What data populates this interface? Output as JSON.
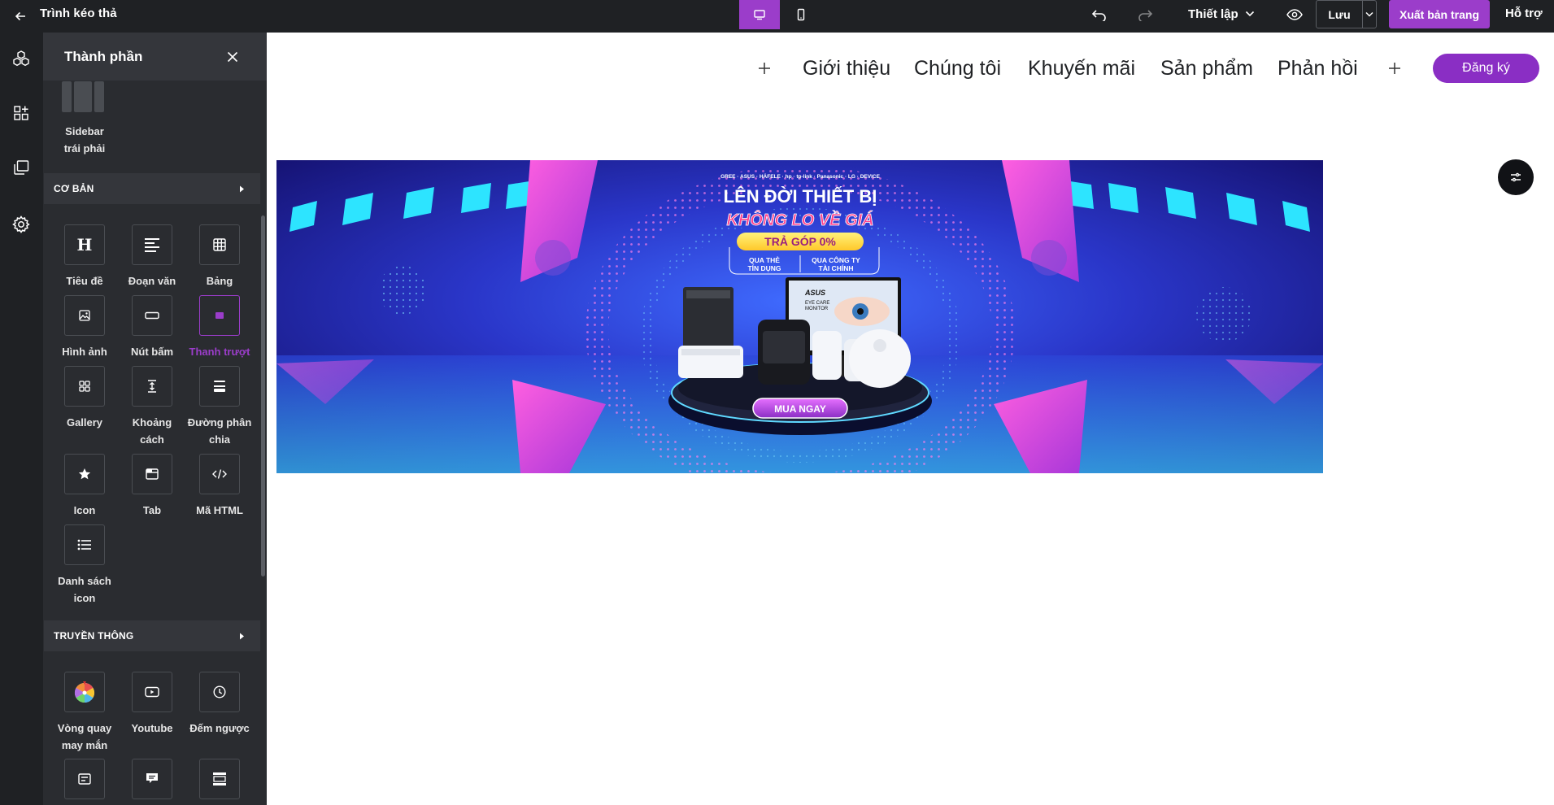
{
  "topbar": {
    "title": "Trình kéo thả",
    "settings_label": "Thiết lập",
    "save_label": "Lưu",
    "publish_label": "Xuất bản trang",
    "help_label": "Hỗ trợ",
    "desktop_mode_color": "#9b3dca"
  },
  "panel": {
    "title": "Thành phần",
    "sidebar_item": {
      "label_line1": "Sidebar",
      "label_line2": "trái phải"
    },
    "section_basic": "CƠ BẢN",
    "section_media": "TRUYỀN THÔNG",
    "basic_items": [
      {
        "label": "Tiêu đề",
        "icon": "heading-icon"
      },
      {
        "label": "Đoạn văn",
        "icon": "paragraph-icon"
      },
      {
        "label": "Bảng",
        "icon": "table-icon"
      },
      {
        "label": "Hình ảnh",
        "icon": "image-icon"
      },
      {
        "label": "Nút bấm",
        "icon": "button-icon"
      },
      {
        "label": "Thanh trượt",
        "icon": "slider-icon",
        "active": true
      },
      {
        "label": "Gallery",
        "icon": "gallery-icon"
      },
      {
        "label_line1": "Khoảng",
        "label_line2": "cách",
        "icon": "spacer-icon"
      },
      {
        "label_line1": "Đường phân",
        "label_line2": "chia",
        "icon": "divider-icon"
      },
      {
        "label": "Icon",
        "icon": "star-icon"
      },
      {
        "label": "Tab",
        "icon": "tab-icon"
      },
      {
        "label": "Mã HTML",
        "icon": "code-icon"
      },
      {
        "label_line1": "Danh sách",
        "label_line2": "icon",
        "icon": "icon-list-icon"
      }
    ],
    "media_items": [
      {
        "label_line1": "Vòng quay",
        "label_line2": "may mắn",
        "icon": "lucky-wheel-icon"
      },
      {
        "label": "Youtube",
        "icon": "youtube-icon"
      },
      {
        "label": "Đếm ngược",
        "icon": "countdown-icon"
      }
    ],
    "accent_color": "#9b3dca"
  },
  "canvas": {
    "nav": {
      "items": [
        "Giới thiệu",
        "Chúng tôi",
        "Khuyến mãi",
        "Sản phẩm",
        "Phản hồi"
      ],
      "register_label": "Đăng ký",
      "register_color": "#8a2ec4"
    },
    "banner": {
      "brands": "GREE · ASUS · HÄFELE · hp · tp-link · Panasonic · LG · DEVICE",
      "headline_1": "LÊN ĐỜI THIẾT BỊ",
      "headline_2": "KHÔNG LO VỀ GIÁ",
      "badge": "TRẢ GÓP 0%",
      "option_1_line1": "QUA THẺ",
      "option_1_line2": "TÍN DỤNG",
      "option_2_line1": "QUA CÔNG TY",
      "option_2_line2": "TÀI CHÍNH",
      "monitor_brand": "ASUS",
      "monitor_text_1": "EYE CARE",
      "monitor_text_2": "MONITOR",
      "cta": "MUA NGAY"
    }
  }
}
